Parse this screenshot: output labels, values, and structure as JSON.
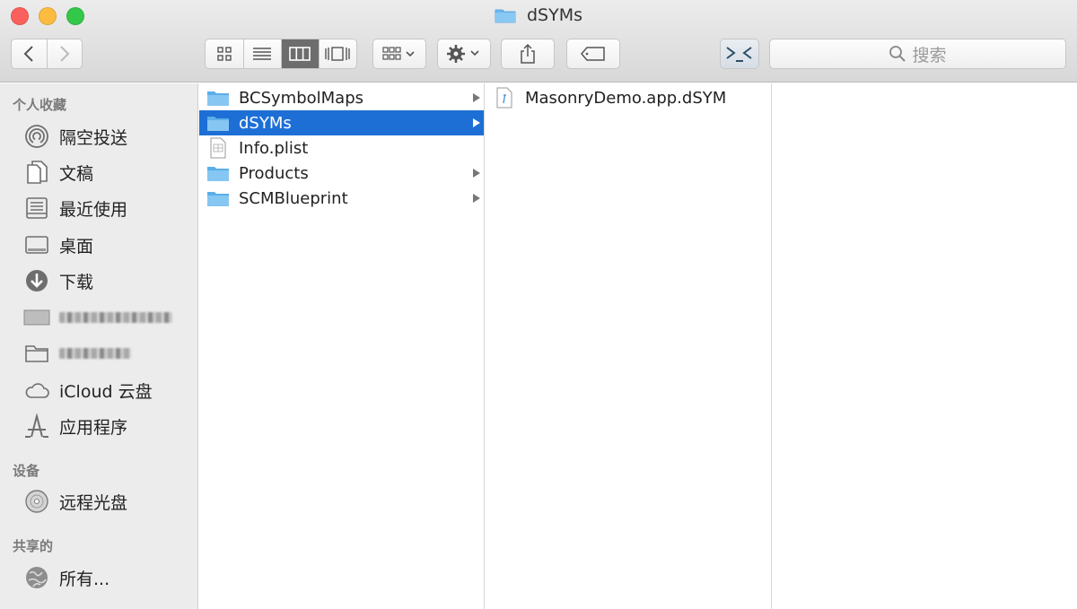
{
  "window": {
    "title": "dSYMs"
  },
  "toolbar": {
    "search_placeholder": "搜索"
  },
  "sidebar": {
    "favorites_header": "个人收藏",
    "favorites": [
      {
        "label": "隔空投送",
        "icon": "airdrop-icon"
      },
      {
        "label": "文稿",
        "icon": "documents-icon"
      },
      {
        "label": "最近使用",
        "icon": "recents-icon"
      },
      {
        "label": "桌面",
        "icon": "desktop-icon"
      },
      {
        "label": "下载",
        "icon": "downloads-icon"
      },
      {
        "label": "iCloud 云盘",
        "icon": "cloud-icon"
      },
      {
        "label": "应用程序",
        "icon": "applications-icon"
      }
    ],
    "devices_header": "设备",
    "devices": [
      {
        "label": "远程光盘",
        "icon": "disc-icon"
      }
    ],
    "shared_header": "共享的",
    "shared": [
      {
        "label": "所有...",
        "icon": "network-icon"
      }
    ]
  },
  "column1": {
    "items": [
      {
        "label": "BCSymbolMaps",
        "kind": "folder",
        "has_children": true
      },
      {
        "label": "dSYMs",
        "kind": "folder",
        "has_children": true,
        "selected": true
      },
      {
        "label": "Info.plist",
        "kind": "plist",
        "has_children": false
      },
      {
        "label": "Products",
        "kind": "folder",
        "has_children": true
      },
      {
        "label": "SCMBlueprint",
        "kind": "folder",
        "has_children": true
      }
    ]
  },
  "column2": {
    "items": [
      {
        "label": "MasonryDemo.app.dSYM",
        "kind": "dsym",
        "has_children": false
      }
    ]
  },
  "colors": {
    "selection": "#1d6fd6",
    "folder": "#6cb9ef"
  }
}
